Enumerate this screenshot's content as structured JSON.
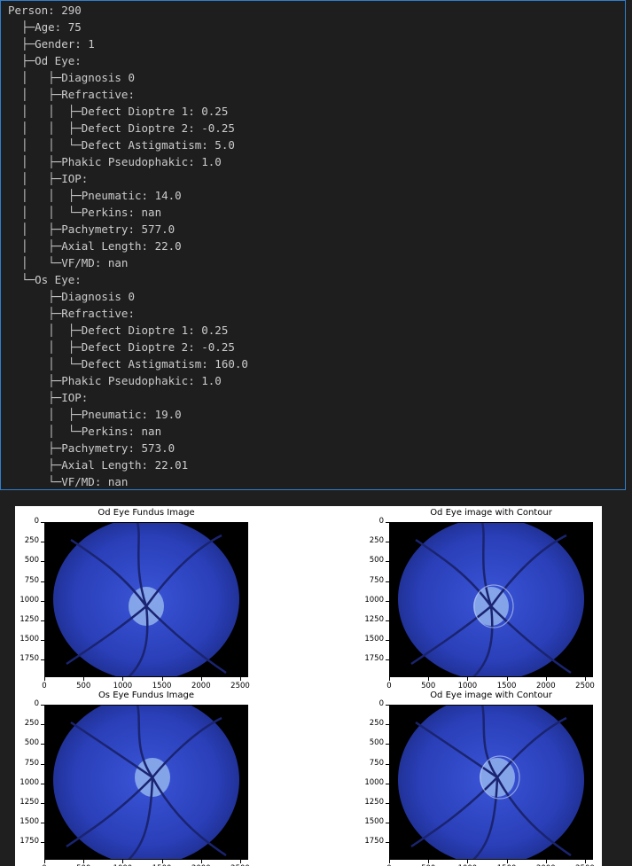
{
  "tree": {
    "lines": [
      "Person: 290",
      "  ├─Age: 75",
      "  ├─Gender: 1",
      "  ├─Od Eye:",
      "  │   ├─Diagnosis 0",
      "  │   ├─Refractive:",
      "  │   │  ├─Defect Dioptre 1: 0.25",
      "  │   │  ├─Defect Dioptre 2: -0.25",
      "  │   │  └─Defect Astigmatism: 5.0",
      "  │   ├─Phakic Pseudophakic: 1.0",
      "  │   ├─IOP:",
      "  │   │  ├─Pneumatic: 14.0",
      "  │   │  └─Perkins: nan",
      "  │   ├─Pachymetry: 577.0",
      "  │   ├─Axial Length: 22.0",
      "  │   └─VF/MD: nan",
      "  └─Os Eye:",
      "      ├─Diagnosis 0",
      "      ├─Refractive:",
      "      │  ├─Defect Dioptre 1: 0.25",
      "      │  ├─Defect Dioptre 2: -0.25",
      "      │  └─Defect Astigmatism: 160.0",
      "      ├─Phakic Pseudophakic: 1.0",
      "      ├─IOP:",
      "      │  ├─Pneumatic: 19.0",
      "      │  └─Perkins: nan",
      "      ├─Pachymetry: 573.0",
      "      ├─Axial Length: 22.01",
      "      └─VF/MD: nan"
    ]
  },
  "figure": {
    "subplots": [
      {
        "title": "Od Eye Fundus Image",
        "contour": false,
        "variant": "od"
      },
      {
        "title": "Od Eye image with Contour",
        "contour": true,
        "variant": "od"
      },
      {
        "title": "Os Eye Fundus Image",
        "contour": false,
        "variant": "os"
      },
      {
        "title": "Od Eye image with Contour",
        "contour": true,
        "variant": "os"
      }
    ],
    "y_ticks": [
      "0",
      "250",
      "500",
      "750",
      "1000",
      "1250",
      "1500",
      "1750"
    ],
    "x_ticks": [
      "0",
      "500",
      "1000",
      "1500",
      "2000",
      "2500"
    ],
    "colors": {
      "fundus": "#2a3fb8",
      "vessel": "#1a2470",
      "disc": "#9fc0f0"
    }
  }
}
